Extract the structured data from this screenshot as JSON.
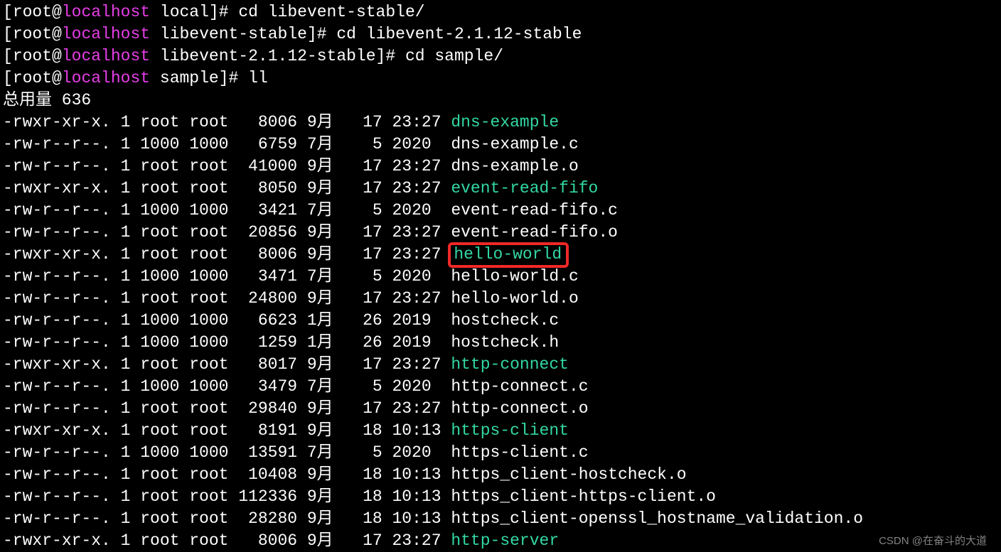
{
  "prompts": [
    {
      "user": "root",
      "host": "localhost",
      "dir": "local",
      "cmd": "cd libevent-stable/"
    },
    {
      "user": "root",
      "host": "localhost",
      "dir": "libevent-stable",
      "cmd": "cd libevent-2.1.12-stable"
    },
    {
      "user": "root",
      "host": "localhost",
      "dir": "libevent-2.1.12-stable",
      "cmd": "cd sample/"
    },
    {
      "user": "root",
      "host": "localhost",
      "dir": "sample",
      "cmd": "ll"
    }
  ],
  "total_line": "总用量 636",
  "files": [
    {
      "perm": "-rwxr-xr-x.",
      "links": "1",
      "owner": "root",
      "group": "root",
      "size": "8006",
      "month": "9月",
      "day": "17",
      "time": "23:27",
      "name": "dns-example",
      "exe": true,
      "hl": false
    },
    {
      "perm": "-rw-r--r--.",
      "links": "1",
      "owner": "1000",
      "group": "1000",
      "size": "6759",
      "month": "7月",
      "day": "5",
      "time": "2020",
      "name": "dns-example.c",
      "exe": false,
      "hl": false
    },
    {
      "perm": "-rw-r--r--.",
      "links": "1",
      "owner": "root",
      "group": "root",
      "size": "41000",
      "month": "9月",
      "day": "17",
      "time": "23:27",
      "name": "dns-example.o",
      "exe": false,
      "hl": false
    },
    {
      "perm": "-rwxr-xr-x.",
      "links": "1",
      "owner": "root",
      "group": "root",
      "size": "8050",
      "month": "9月",
      "day": "17",
      "time": "23:27",
      "name": "event-read-fifo",
      "exe": true,
      "hl": false
    },
    {
      "perm": "-rw-r--r--.",
      "links": "1",
      "owner": "1000",
      "group": "1000",
      "size": "3421",
      "month": "7月",
      "day": "5",
      "time": "2020",
      "name": "event-read-fifo.c",
      "exe": false,
      "hl": false
    },
    {
      "perm": "-rw-r--r--.",
      "links": "1",
      "owner": "root",
      "group": "root",
      "size": "20856",
      "month": "9月",
      "day": "17",
      "time": "23:27",
      "name": "event-read-fifo.o",
      "exe": false,
      "hl": false
    },
    {
      "perm": "-rwxr-xr-x.",
      "links": "1",
      "owner": "root",
      "group": "root",
      "size": "8006",
      "month": "9月",
      "day": "17",
      "time": "23:27",
      "name": "hello-world",
      "exe": true,
      "hl": true
    },
    {
      "perm": "-rw-r--r--.",
      "links": "1",
      "owner": "1000",
      "group": "1000",
      "size": "3471",
      "month": "7月",
      "day": "5",
      "time": "2020",
      "name": "hello-world.c",
      "exe": false,
      "hl": false
    },
    {
      "perm": "-rw-r--r--.",
      "links": "1",
      "owner": "root",
      "group": "root",
      "size": "24800",
      "month": "9月",
      "day": "17",
      "time": "23:27",
      "name": "hello-world.o",
      "exe": false,
      "hl": false
    },
    {
      "perm": "-rw-r--r--.",
      "links": "1",
      "owner": "1000",
      "group": "1000",
      "size": "6623",
      "month": "1月",
      "day": "26",
      "time": "2019",
      "name": "hostcheck.c",
      "exe": false,
      "hl": false
    },
    {
      "perm": "-rw-r--r--.",
      "links": "1",
      "owner": "1000",
      "group": "1000",
      "size": "1259",
      "month": "1月",
      "day": "26",
      "time": "2019",
      "name": "hostcheck.h",
      "exe": false,
      "hl": false
    },
    {
      "perm": "-rwxr-xr-x.",
      "links": "1",
      "owner": "root",
      "group": "root",
      "size": "8017",
      "month": "9月",
      "day": "17",
      "time": "23:27",
      "name": "http-connect",
      "exe": true,
      "hl": false
    },
    {
      "perm": "-rw-r--r--.",
      "links": "1",
      "owner": "1000",
      "group": "1000",
      "size": "3479",
      "month": "7月",
      "day": "5",
      "time": "2020",
      "name": "http-connect.c",
      "exe": false,
      "hl": false
    },
    {
      "perm": "-rw-r--r--.",
      "links": "1",
      "owner": "root",
      "group": "root",
      "size": "29840",
      "month": "9月",
      "day": "17",
      "time": "23:27",
      "name": "http-connect.o",
      "exe": false,
      "hl": false
    },
    {
      "perm": "-rwxr-xr-x.",
      "links": "1",
      "owner": "root",
      "group": "root",
      "size": "8191",
      "month": "9月",
      "day": "18",
      "time": "10:13",
      "name": "https-client",
      "exe": true,
      "hl": false
    },
    {
      "perm": "-rw-r--r--.",
      "links": "1",
      "owner": "1000",
      "group": "1000",
      "size": "13591",
      "month": "7月",
      "day": "5",
      "time": "2020",
      "name": "https-client.c",
      "exe": false,
      "hl": false
    },
    {
      "perm": "-rw-r--r--.",
      "links": "1",
      "owner": "root",
      "group": "root",
      "size": "10408",
      "month": "9月",
      "day": "18",
      "time": "10:13",
      "name": "https_client-hostcheck.o",
      "exe": false,
      "hl": false
    },
    {
      "perm": "-rw-r--r--.",
      "links": "1",
      "owner": "root",
      "group": "root",
      "size": "112336",
      "month": "9月",
      "day": "18",
      "time": "10:13",
      "name": "https_client-https-client.o",
      "exe": false,
      "hl": false
    },
    {
      "perm": "-rw-r--r--.",
      "links": "1",
      "owner": "root",
      "group": "root",
      "size": "28280",
      "month": "9月",
      "day": "18",
      "time": "10:13",
      "name": "https_client-openssl_hostname_validation.o",
      "exe": false,
      "hl": false
    },
    {
      "perm": "-rwxr-xr-x.",
      "links": "1",
      "owner": "root",
      "group": "root",
      "size": "8006",
      "month": "9月",
      "day": "17",
      "time": "23:27",
      "name": "http-server",
      "exe": true,
      "hl": false
    }
  ],
  "watermark": "CSDN @在奋斗的大道"
}
